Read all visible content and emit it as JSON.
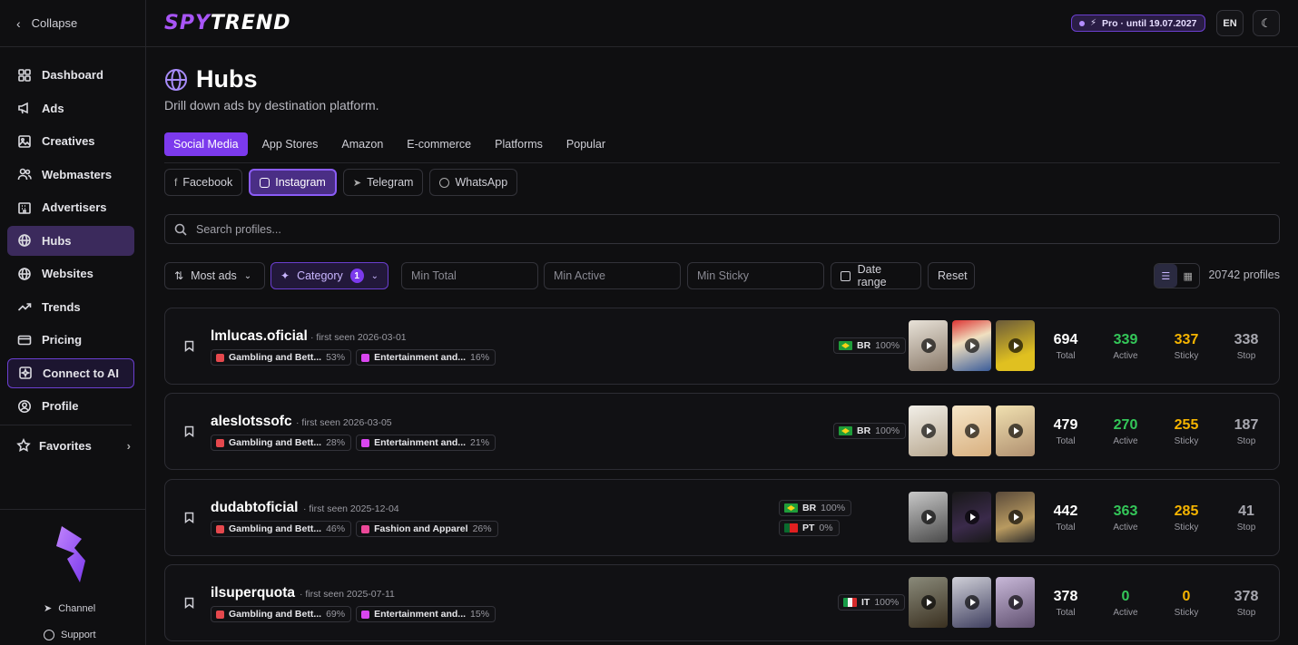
{
  "sidebar": {
    "collapse_label": "Collapse",
    "items": [
      {
        "label": "Dashboard",
        "icon": "dashboard-icon"
      },
      {
        "label": "Ads",
        "icon": "megaphone-icon"
      },
      {
        "label": "Creatives",
        "icon": "image-icon"
      },
      {
        "label": "Webmasters",
        "icon": "users-icon"
      },
      {
        "label": "Advertisers",
        "icon": "building-icon"
      },
      {
        "label": "Hubs",
        "icon": "globe-icon",
        "active": true
      },
      {
        "label": "Websites",
        "icon": "globe-icon"
      },
      {
        "label": "Trends",
        "icon": "trend-icon"
      },
      {
        "label": "Pricing",
        "icon": "card-icon"
      },
      {
        "label": "Connect to AI",
        "icon": "sparkle-icon"
      },
      {
        "label": "Profile",
        "icon": "user-icon"
      }
    ],
    "favorites_label": "Favorites",
    "channel_label": "Channel",
    "support_label": "Support"
  },
  "topbar": {
    "logo_part1": "SPY",
    "logo_part2": "TREND",
    "pro_badge": "Pro · until 19.07.2027",
    "lang": "EN"
  },
  "page": {
    "title": "Hubs",
    "subtitle": "Drill down ads by destination platform."
  },
  "tabs": [
    "Social Media",
    "App Stores",
    "Amazon",
    "E-commerce",
    "Platforms",
    "Popular"
  ],
  "platforms": [
    "Facebook",
    "Instagram",
    "Telegram",
    "WhatsApp"
  ],
  "search": {
    "placeholder": "Search profiles..."
  },
  "filters": {
    "sort": "Most ads",
    "category": "Category",
    "category_count": "1",
    "min_total": "Min Total",
    "min_active": "Min Active",
    "min_sticky": "Min Sticky",
    "date_range": "Date range",
    "reset": "Reset",
    "profile_count": "20742 profiles"
  },
  "stat_labels": {
    "total": "Total",
    "active": "Active",
    "sticky": "Sticky",
    "stop": "Stop"
  },
  "profiles": [
    {
      "name": "lmlucas.oficial",
      "first_seen": "· first seen 2026-03-01",
      "categories": [
        {
          "label": "Gambling and Bett...",
          "pct": "53%",
          "color": "#e5484d"
        },
        {
          "label": "Entertainment and...",
          "pct": "16%",
          "color": "#d946ef"
        }
      ],
      "geos": [
        {
          "code": "BR",
          "pct": "100%",
          "flag": "br"
        }
      ],
      "total": "694",
      "active": "339",
      "sticky": "337",
      "stop": "338"
    },
    {
      "name": "aleslotssofc",
      "first_seen": "· first seen 2026-03-05",
      "categories": [
        {
          "label": "Gambling and Bett...",
          "pct": "28%",
          "color": "#e5484d"
        },
        {
          "label": "Entertainment and...",
          "pct": "21%",
          "color": "#d946ef"
        }
      ],
      "geos": [
        {
          "code": "BR",
          "pct": "100%",
          "flag": "br"
        }
      ],
      "total": "479",
      "active": "270",
      "sticky": "255",
      "stop": "187"
    },
    {
      "name": "dudabtoficial",
      "first_seen": "· first seen 2025-12-04",
      "categories": [
        {
          "label": "Gambling and Bett...",
          "pct": "46%",
          "color": "#e5484d"
        },
        {
          "label": "Fashion and Apparel",
          "pct": "26%",
          "color": "#ec4899"
        }
      ],
      "geos": [
        {
          "code": "BR",
          "pct": "100%",
          "flag": "br"
        },
        {
          "code": "PT",
          "pct": "0%",
          "flag": "pt"
        }
      ],
      "total": "442",
      "active": "363",
      "sticky": "285",
      "stop": "41"
    },
    {
      "name": "ilsuperquota",
      "first_seen": "· first seen 2025-07-11",
      "categories": [
        {
          "label": "Gambling and Bett...",
          "pct": "69%",
          "color": "#e5484d"
        },
        {
          "label": "Entertainment and...",
          "pct": "15%",
          "color": "#d946ef"
        }
      ],
      "geos": [
        {
          "code": "IT",
          "pct": "100%",
          "flag": "it"
        }
      ],
      "total": "378",
      "active": "0",
      "sticky": "0",
      "stop": "378"
    }
  ]
}
